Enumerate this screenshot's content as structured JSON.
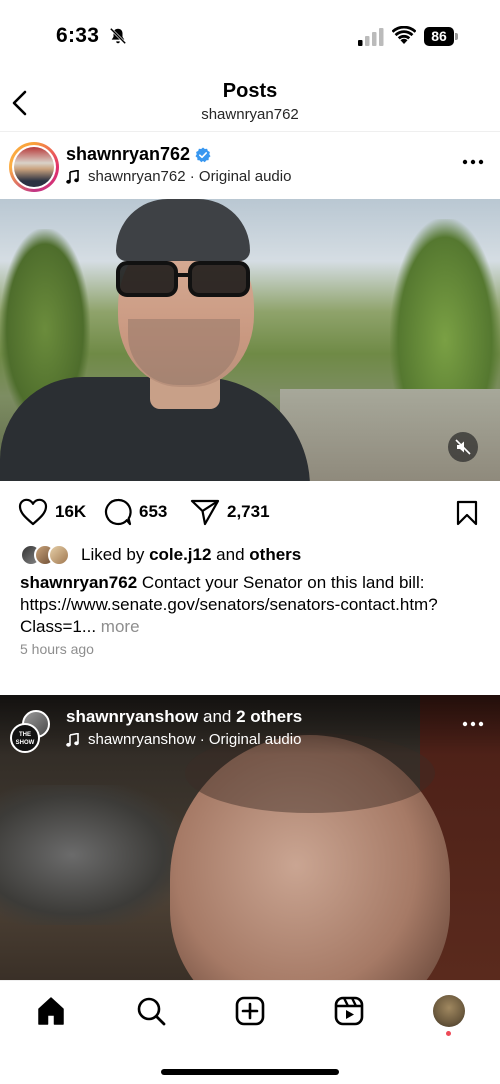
{
  "status_bar": {
    "time": "6:33",
    "battery": "86"
  },
  "header": {
    "title": "Posts",
    "subtitle": "shawnryan762"
  },
  "post1": {
    "username": "shawnryan762",
    "audio": "shawnryan762 · Original audio",
    "likes_count": "16K",
    "comments_count": "653",
    "shares_count": "2,731",
    "liked_by_prefix": "Liked by ",
    "liked_by_user": "cole.j12",
    "liked_by_and": " and ",
    "liked_by_others": "others",
    "caption_user": "shawnryan762",
    "caption_text": " Contact your Senator on this land bill: https://www.senate.gov/senators/senators-contact.htm?Class=1...",
    "caption_more": "more",
    "time_ago": "5 hours ago"
  },
  "post2": {
    "username": "shawnryanshow",
    "and_text": " and ",
    "others": "2 others",
    "audio": "shawnryanshow · Original audio",
    "avatar_badge": "THE SHOW"
  },
  "icons": {
    "status": [
      "bell-off-icon",
      "signal-icon",
      "wifi-icon",
      "battery-icon"
    ],
    "post": [
      "verified-icon",
      "music-note-icon",
      "more-icon",
      "mute-icon",
      "heart-icon",
      "comment-icon",
      "share-icon",
      "bookmark-icon"
    ],
    "tabs": [
      "home-icon",
      "search-icon",
      "create-icon",
      "reels-icon",
      "profile-avatar"
    ]
  },
  "colors": {
    "verified": "#3897f0",
    "secondary_text": "#8e8e8e",
    "notification_dot": "#ed4956"
  }
}
